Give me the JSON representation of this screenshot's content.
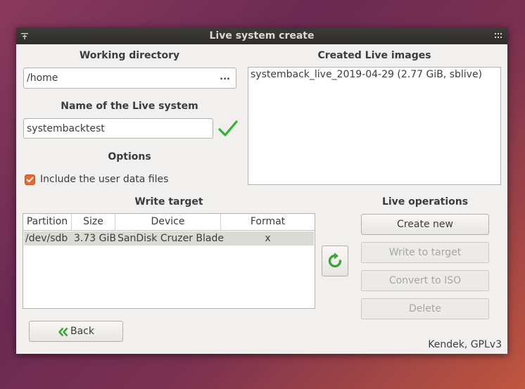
{
  "window": {
    "title": "Live system create",
    "menu_icon": "menu-icon",
    "grip_icon": "grip-icon"
  },
  "working_directory": {
    "heading": "Working directory",
    "value": "/home",
    "browse_label": "..."
  },
  "live_name": {
    "heading": "Name of the Live system",
    "value": "systembacktest",
    "valid_icon": "checkmark-icon",
    "valid_color": "#2fb62f"
  },
  "options": {
    "heading": "Options",
    "include_user_data": {
      "label": "Include the user data files",
      "checked": true,
      "color": "#e9682f"
    }
  },
  "created_images": {
    "heading": "Created Live images",
    "items": [
      "systemback_live_2019-04-29 (2.77 GiB, sblive)"
    ]
  },
  "write_target": {
    "heading": "Write target",
    "columns": [
      "Partition",
      "Size",
      "Device",
      "Format"
    ],
    "rows": [
      {
        "partition": "/dev/sdb",
        "size": "3.73 GiB",
        "device": "SanDisk Cruzer Blade",
        "format": "x"
      }
    ],
    "refresh_icon": "refresh-icon",
    "refresh_color": "#3aa63a"
  },
  "live_operations": {
    "heading": "Live operations",
    "create_new": "Create new",
    "write_to_target": "Write to target",
    "convert_to_iso": "Convert to ISO",
    "delete": "Delete"
  },
  "back": {
    "label": "Back",
    "icon": "double-chevron-left-icon"
  },
  "footer": {
    "credit": "Kendek, GPLv3"
  }
}
